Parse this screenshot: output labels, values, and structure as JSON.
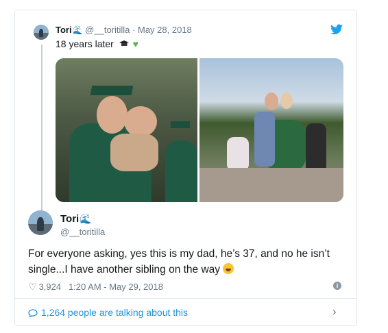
{
  "quoted_tweet": {
    "name": "Tori",
    "name_emoji": "wave-icon",
    "handle": "@__toritilla",
    "separator": "·",
    "date": "May 28, 2018",
    "text": "18 years later",
    "emojis": [
      "graduation-cap-icon",
      "green-heart-icon"
    ]
  },
  "tweet": {
    "name": "Tori",
    "handle": "@__toritilla",
    "text": "For everyone asking, yes this is my dad, he’s 37, and no he isn’t single...I have another sibling on the way",
    "likes": "3,924",
    "timestamp": "1:20 AM - May 29, 2018"
  },
  "footer": {
    "talking_text": "1,264 people are talking about this"
  },
  "colors": {
    "twitter_blue": "#1da1f2",
    "link_blue": "#1b95e0",
    "muted": "#657786",
    "border": "#e1e8ed"
  }
}
